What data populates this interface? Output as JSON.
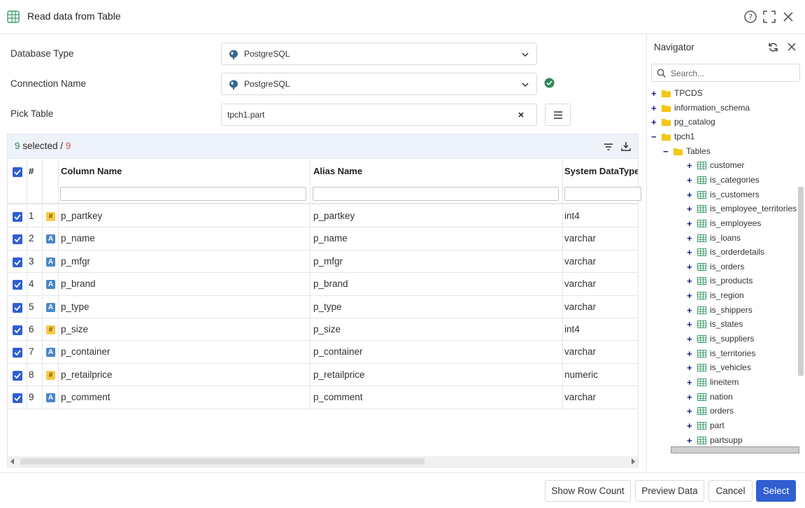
{
  "window": {
    "title": "Read data from Table"
  },
  "form": {
    "db_type_label": "Database Type",
    "db_type_value": "PostgreSQL",
    "connection_label": "Connection Name",
    "connection_value": "PostgreSQL",
    "pick_table_label": "Pick Table",
    "pick_table_value": "tpch1.part"
  },
  "grid": {
    "selected_count": "9",
    "selected_text": " selected / ",
    "total_count": "9",
    "headers": {
      "num": "#",
      "column_name": "Column Name",
      "alias_name": "Alias Name",
      "system_type": "System DataType"
    },
    "rows": [
      {
        "n": "1",
        "badge": "#",
        "kind": "num",
        "name": "p_partkey",
        "alias": "p_partkey",
        "type": "int4"
      },
      {
        "n": "2",
        "badge": "A",
        "kind": "str",
        "name": "p_name",
        "alias": "p_name",
        "type": "varchar"
      },
      {
        "n": "3",
        "badge": "A",
        "kind": "str",
        "name": "p_mfgr",
        "alias": "p_mfgr",
        "type": "varchar"
      },
      {
        "n": "4",
        "badge": "A",
        "kind": "str",
        "name": "p_brand",
        "alias": "p_brand",
        "type": "varchar"
      },
      {
        "n": "5",
        "badge": "A",
        "kind": "str",
        "name": "p_type",
        "alias": "p_type",
        "type": "varchar"
      },
      {
        "n": "6",
        "badge": "#",
        "kind": "num",
        "name": "p_size",
        "alias": "p_size",
        "type": "int4"
      },
      {
        "n": "7",
        "badge": "A",
        "kind": "str",
        "name": "p_container",
        "alias": "p_container",
        "type": "varchar"
      },
      {
        "n": "8",
        "badge": "#",
        "kind": "num",
        "name": "p_retailprice",
        "alias": "p_retailprice",
        "type": "numeric"
      },
      {
        "n": "9",
        "badge": "A",
        "kind": "str",
        "name": "p_comment",
        "alias": "p_comment",
        "type": "varchar"
      }
    ]
  },
  "navigator": {
    "title": "Navigator",
    "search_placeholder": "Search...",
    "tree": [
      {
        "label": "TPCDS",
        "level": 0,
        "exp": "+",
        "icon": "folder"
      },
      {
        "label": "information_schema",
        "level": 0,
        "exp": "+",
        "icon": "folder"
      },
      {
        "label": "pg_catalog",
        "level": 0,
        "exp": "+",
        "icon": "folder"
      },
      {
        "label": "tpch1",
        "level": 0,
        "exp": "−",
        "icon": "folder"
      },
      {
        "label": "Tables",
        "level": 1,
        "exp": "−",
        "icon": "folder"
      },
      {
        "label": "customer",
        "level": 2,
        "exp": "+",
        "icon": "table"
      },
      {
        "label": "is_categories",
        "level": 2,
        "exp": "+",
        "icon": "table"
      },
      {
        "label": "is_customers",
        "level": 2,
        "exp": "+",
        "icon": "table"
      },
      {
        "label": "is_employee_territories",
        "level": 2,
        "exp": "+",
        "icon": "table"
      },
      {
        "label": "is_employees",
        "level": 2,
        "exp": "+",
        "icon": "table"
      },
      {
        "label": "is_loans",
        "level": 2,
        "exp": "+",
        "icon": "table"
      },
      {
        "label": "is_orderdetails",
        "level": 2,
        "exp": "+",
        "icon": "table"
      },
      {
        "label": "is_orders",
        "level": 2,
        "exp": "+",
        "icon": "table"
      },
      {
        "label": "is_products",
        "level": 2,
        "exp": "+",
        "icon": "table"
      },
      {
        "label": "is_region",
        "level": 2,
        "exp": "+",
        "icon": "table"
      },
      {
        "label": "is_shippers",
        "level": 2,
        "exp": "+",
        "icon": "table"
      },
      {
        "label": "is_states",
        "level": 2,
        "exp": "+",
        "icon": "table"
      },
      {
        "label": "is_suppliers",
        "level": 2,
        "exp": "+",
        "icon": "table"
      },
      {
        "label": "is_territories",
        "level": 2,
        "exp": "+",
        "icon": "table"
      },
      {
        "label": "is_vehicles",
        "level": 2,
        "exp": "+",
        "icon": "table"
      },
      {
        "label": "lineitem",
        "level": 2,
        "exp": "+",
        "icon": "table"
      },
      {
        "label": "nation",
        "level": 2,
        "exp": "+",
        "icon": "table"
      },
      {
        "label": "orders",
        "level": 2,
        "exp": "+",
        "icon": "table"
      },
      {
        "label": "part",
        "level": 2,
        "exp": "+",
        "icon": "table"
      },
      {
        "label": "partsupp",
        "level": 2,
        "exp": "+",
        "icon": "table"
      }
    ]
  },
  "footer": {
    "show_row_count": "Show Row Count",
    "preview_data": "Preview Data",
    "cancel": "Cancel",
    "select": "Select"
  },
  "colors": {
    "accent": "#2f5fd0",
    "success": "#2e8b57",
    "warn": "#d9534f",
    "folder": "#f5c518"
  }
}
